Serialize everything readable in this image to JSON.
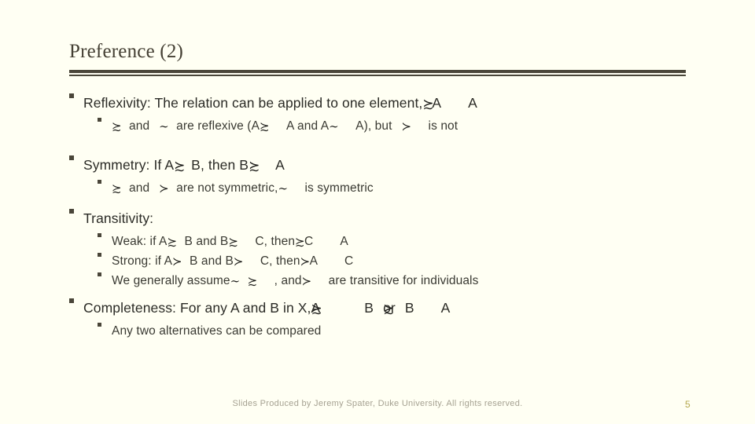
{
  "slide": {
    "title": "Preference (2)",
    "page_number": "5",
    "footer": "Slides Produced by Jeremy Spater, Duke University.  All rights reserved.",
    "colors": {
      "background": "#fffff3",
      "rule": "#4a4639",
      "title_text": "#443f33",
      "body_text": "#2b2b26",
      "sub_text": "#3a3a33",
      "footer_text": "#a6a292",
      "page_number": "#b4a84e"
    },
    "symbols": {
      "succeeds_or_equivalent": "≿",
      "succeeds": "≻",
      "equivalent": "∼"
    },
    "bullets": [
      {
        "level1_prefix": "Reflexivity: The relation can be applied to one element,",
        "level1_rel": "≿",
        "level1_mid": "A",
        "level1_suffix": "A",
        "sub": [
          {
            "rel_a": "≿",
            "t1": "and",
            "rel_b": "∼",
            "t2": "are reflexive (A",
            "rel_c": "≿",
            "t3": "A and A",
            "rel_d": "∼",
            "t4": "A), but",
            "rel_e": "≻",
            "t5": "is not"
          }
        ]
      },
      {
        "level1_prefix": "Symmetry: If A",
        "level1_rel": "≿",
        "level1_mid": "B, then B",
        "level1_rel2": "≿",
        "level1_suffix": "A",
        "sub": [
          {
            "rel_a": "≿",
            "t1": "and",
            "rel_b": "≻",
            "t2": "are not symmetric,",
            "rel_c": "∼",
            "t3": "is symmetric"
          }
        ]
      },
      {
        "level1_prefix": "Transitivity:",
        "sub": [
          {
            "label": "Weak: if A",
            "rel_a": "≿",
            "t1": "B and B",
            "rel_b": "≿",
            "t2": "C, then",
            "rel_c": "≿",
            "t3": "C",
            "t4": "A"
          },
          {
            "label": "Strong: if A",
            "rel_a": "≻",
            "t1": "B and B",
            "rel_b": "≻",
            "t2": "C, then",
            "rel_c": "≻",
            "t3": "A",
            "t4": "C"
          },
          {
            "label": "We generally assume",
            "rel_a": "∼",
            "t1": ",",
            "rel_b": "≿",
            "t2": ", and",
            "rel_c": "≻",
            "t3": "are transitive for individuals"
          }
        ]
      },
      {
        "level1_prefix": "Completeness: For any A and B in X,",
        "level1_rel": "≿",
        "level1_mid": "A",
        "level1_mid2": "B",
        "level1_rel2": "≿",
        "level1_tail_a": "or",
        "level1_tail_b": "B",
        "level1_suffix": "A",
        "sub": [
          {
            "label": "Any two alternatives can be compared"
          }
        ]
      }
    ]
  }
}
